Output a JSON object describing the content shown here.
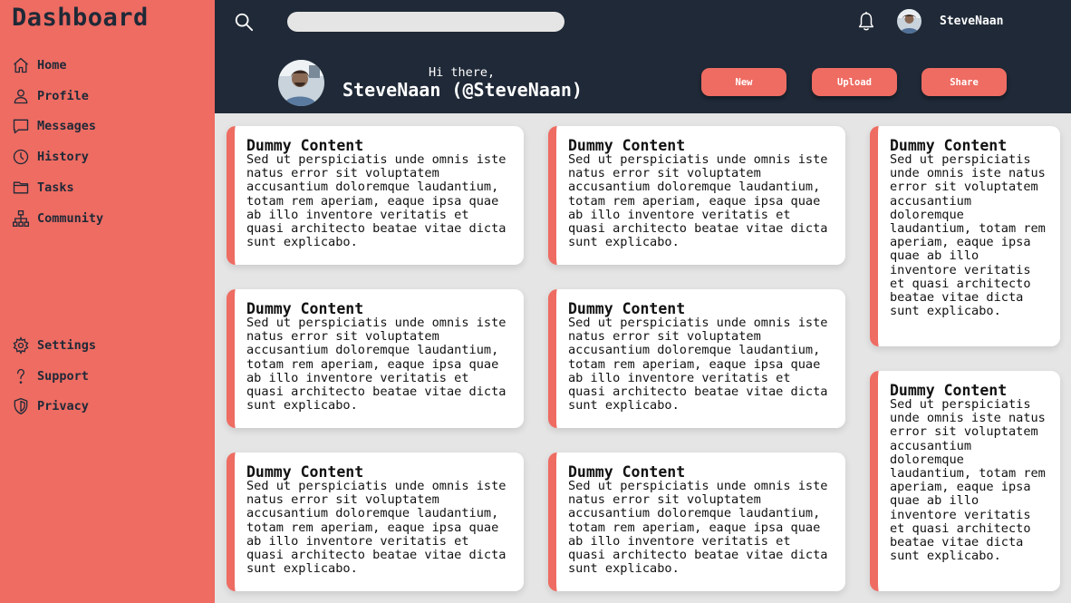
{
  "sidebar": {
    "brand": "Dashboard",
    "nav_top": [
      {
        "label": "Home",
        "icon": "home-icon"
      },
      {
        "label": "Profile",
        "icon": "user-icon"
      },
      {
        "label": "Messages",
        "icon": "chat-icon"
      },
      {
        "label": "History",
        "icon": "clock-icon"
      },
      {
        "label": "Tasks",
        "icon": "folder-icon"
      },
      {
        "label": "Community",
        "icon": "network-icon"
      }
    ],
    "nav_bottom": [
      {
        "label": "Settings",
        "icon": "gear-icon"
      },
      {
        "label": "Support",
        "icon": "question-icon"
      },
      {
        "label": "Privacy",
        "icon": "shield-icon"
      }
    ]
  },
  "header": {
    "search_placeholder": "",
    "username": "SteveNaan",
    "greeting": "Hi there,",
    "fullname": "SteveNaan (@SteveNaan)",
    "buttons": {
      "new": "New",
      "upload": "Upload",
      "share": "Share"
    }
  },
  "cards": [
    {
      "title": "Dummy Content",
      "body": "Sed ut perspiciatis unde omnis iste natus error sit voluptatem accusantium doloremque laudantium, totam rem aperiam, eaque ipsa quae ab illo inventore veritatis et quasi architecto beatae vitae dicta sunt explicabo."
    },
    {
      "title": "Dummy Content",
      "body": "Sed ut perspiciatis unde omnis iste natus error sit voluptatem accusantium doloremque laudantium, totam rem aperiam, eaque ipsa quae ab illo inventore veritatis et quasi architecto beatae vitae dicta sunt explicabo."
    },
    {
      "title": "Dummy Content",
      "body": "Sed ut perspiciatis unde omnis iste natus error sit voluptatem accusantium doloremque laudantium, totam rem aperiam, eaque ipsa quae ab illo inventore veritatis et quasi architecto beatae vitae dicta sunt explicabo."
    },
    {
      "title": "Dummy Content",
      "body": "Sed ut perspiciatis unde omnis iste natus error sit voluptatem accusantium doloremque laudantium, totam rem aperiam, eaque ipsa quae ab illo inventore veritatis et quasi architecto beatae vitae dicta sunt explicabo."
    },
    {
      "title": "Dummy Content",
      "body": "Sed ut perspiciatis unde omnis iste natus error sit voluptatem accusantium doloremque laudantium, totam rem aperiam, eaque ipsa quae ab illo inventore veritatis et quasi architecto beatae vitae dicta sunt explicabo."
    },
    {
      "title": "Dummy Content",
      "body": "Sed ut perspiciatis unde omnis iste natus error sit voluptatem accusantium doloremque laudantium, totam rem aperiam, eaque ipsa quae ab illo inventore veritatis et quasi architecto beatae vitae dicta sunt explicabo."
    },
    {
      "title": "Dummy Content",
      "body": "Sed ut perspiciatis unde omnis iste natus error sit voluptatem accusantium doloremque laudantium, totam rem aperiam, eaque ipsa quae ab illo inventore veritatis et quasi architecto beatae vitae dicta sunt explicabo."
    },
    {
      "title": "Dummy Content",
      "body": "Sed ut perspiciatis unde omnis iste natus error sit voluptatem accusantium doloremque laudantium, totam rem aperiam, eaque ipsa quae ab illo inventore veritatis et quasi architecto beatae vitae dicta sunt explicabo."
    },
    {
      "title": "Dummy Content",
      "body": "Sed ut perspiciatis unde omnis iste natus error sit voluptatem accusantium doloremque laudantium, totam rem aperiam, eaque ipsa quae ab illo inventore veritatis et quasi architecto beatae vitae dicta sunt explicabo."
    }
  ],
  "colors": {
    "accent": "#ee6c62",
    "header_bg": "#1f2937",
    "content_bg": "#e5e5e5"
  }
}
